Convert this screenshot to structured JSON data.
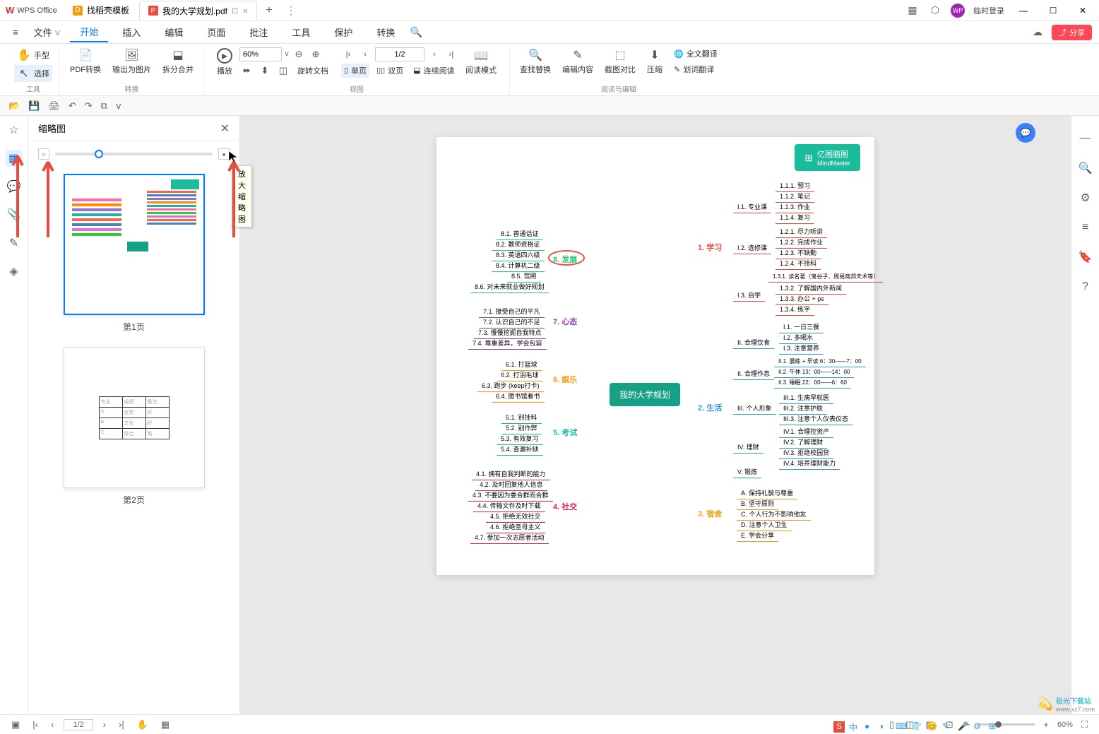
{
  "app": {
    "name": "WPS Office"
  },
  "tabs": [
    {
      "icon": "D",
      "label": "找稻壳模板",
      "color": "orange"
    },
    {
      "icon": "P",
      "label": "我的大学规划.pdf",
      "color": "red",
      "active": true
    }
  ],
  "titlebar": {
    "login": "临时登录"
  },
  "menu": {
    "file": "文件",
    "items": [
      "开始",
      "插入",
      "编辑",
      "页面",
      "批注",
      "工具",
      "保护",
      "转换"
    ],
    "active": "开始",
    "share": "分享"
  },
  "ribbon": {
    "tools": {
      "hand": "手型",
      "select": "选择",
      "label": "工具"
    },
    "convert": {
      "pdf": "PDF转换",
      "img": "输出为图片",
      "split": "拆分合并",
      "label": "转换"
    },
    "view": {
      "play": "播放",
      "zoom": "60%",
      "page": "1/2",
      "rotate": "旋转文档",
      "single": "单页",
      "double": "双页",
      "continuous": "连续阅读",
      "mode": "阅读模式",
      "label": "视图"
    },
    "edit": {
      "find": "查找替换",
      "editcontent": "编辑内容",
      "screenshot": "截图对比",
      "compress": "压缩",
      "fulltext": "全文翻译",
      "words": "划词翻译",
      "label": "阅读与编辑"
    }
  },
  "thumbnail": {
    "title": "缩略图",
    "tooltip": "放大缩略图",
    "page1": "第1页",
    "page2": "第2页"
  },
  "mindmap": {
    "badge_cn": "亿图脑图",
    "badge_en": "MindMaster",
    "center": "我的大学规划",
    "branches": {
      "b1": "1. 学习",
      "b1_1": "I.1. 专业课",
      "b1_2": "I.2. 选修课",
      "b1_3": "I.3. 自学",
      "b1_1_1": "1.1.1. 预习",
      "b1_1_2": "1.1.2. 笔记",
      "b1_1_3": "1.1.3. 作业",
      "b1_1_4": "1.1.4. 复习",
      "b1_2_1": "1.2.1. 尽力听讲",
      "b1_2_2": "1.2.2. 完成作业",
      "b1_2_3": "1.2.3. 不缺勤",
      "b1_2_4": "1.2.4. 不挂科",
      "b1_3_1": "1.3.1. 读名著（鬼谷子、周易商邦天术等）",
      "b1_3_2": "1.3.2. 了解国内外新闻",
      "b1_3_3": "1.3.3. 办公 + ps",
      "b1_3_4": "1.3.4. 练字",
      "b2": "2. 生活",
      "b2_1": "II. 合理饮食",
      "b2_2": "II. 合理作息",
      "b2_3": "III. 个人形象",
      "b2_4": "IV. 理财",
      "b2_5": "V. 锻炼",
      "b2_1_1": "I.1. 一日三餐",
      "b2_1_2": "I.2. 多喝水",
      "b2_1_3": "I.3. 注意营养",
      "b2_2_1": "II.1. 晨练 + 早读 6：30——7：00",
      "b2_2_2": "II.2. 午休 13：00——14：00",
      "b2_2_3": "II.3. 睡眠 22：00——6：60",
      "b2_3_1": "III.1. 生病早就医",
      "b2_3_2": "III.2. 注意护肤",
      "b2_3_3": "III.3. 注意个人仪表仪态",
      "b2_4_1": "IV.1. 合理控资产",
      "b2_4_2": "IV.2. 了解理财",
      "b2_4_3": "IV.3. 拒绝校园贷",
      "b2_4_4": "IV.4. 培养理财能力",
      "b3": "3. 宿舍",
      "b3_1": "A. 保持礼貌与尊重",
      "b3_2": "B. 坚守原则",
      "b3_3": "C. 个人行为不影响他友",
      "b3_4": "D. 注意个人卫生",
      "b3_5": "E. 学会分享",
      "b4": "4. 社交",
      "b4_1": "4.1. 拥有自我判断的能力",
      "b4_2": "4.2. 及时回复他人信息",
      "b4_3": "4.3. 不要因为委合群而合群",
      "b4_4": "4.4. 传输文件及时下载",
      "b4_5": "4.5. 拒绝无效社交",
      "b4_6": "4.6. 拒绝圣母主义",
      "b4_7": "4.7. 参加一次志愿者活动",
      "b5": "5. 考试",
      "b5_1": "5.1. 别挂科",
      "b5_2": "5.2. 别作弊",
      "b5_3": "5.3. 有效复习",
      "b5_4": "5.4. 查漏补缺",
      "b6": "6. 娱乐",
      "b6_1": "6.1. 打篮球",
      "b6_2": "6.2. 打羽毛球",
      "b6_3": "6.3. 跑步 (keep打卡)",
      "b6_4": "6.4. 图书馆看书",
      "b7": "7. 心态",
      "b7_1": "7.1. 接受自己的平凡",
      "b7_2": "7.2. 认识自己的不足",
      "b7_3": "7.3. 慢慢挖掘自我特点",
      "b7_4": "7.4. 尊重差异，学会包容",
      "b8": "8. 发展",
      "b8_1": "8.1. 普通话证",
      "b8_2": "8.2. 教师资格证",
      "b8_3": "8.3. 英语四六级",
      "b8_4": "8.4. 计算机二级",
      "b8_5": "8.5. 驾照",
      "b8_6": "8.6. 对未来就业做好规划"
    }
  },
  "bottombar": {
    "page": "1/2",
    "zoom": "60%"
  },
  "watermark": {
    "text": "极光下载站",
    "url": "www.xz7.com"
  },
  "tray": {
    "s": "S",
    "zhong": "中"
  }
}
